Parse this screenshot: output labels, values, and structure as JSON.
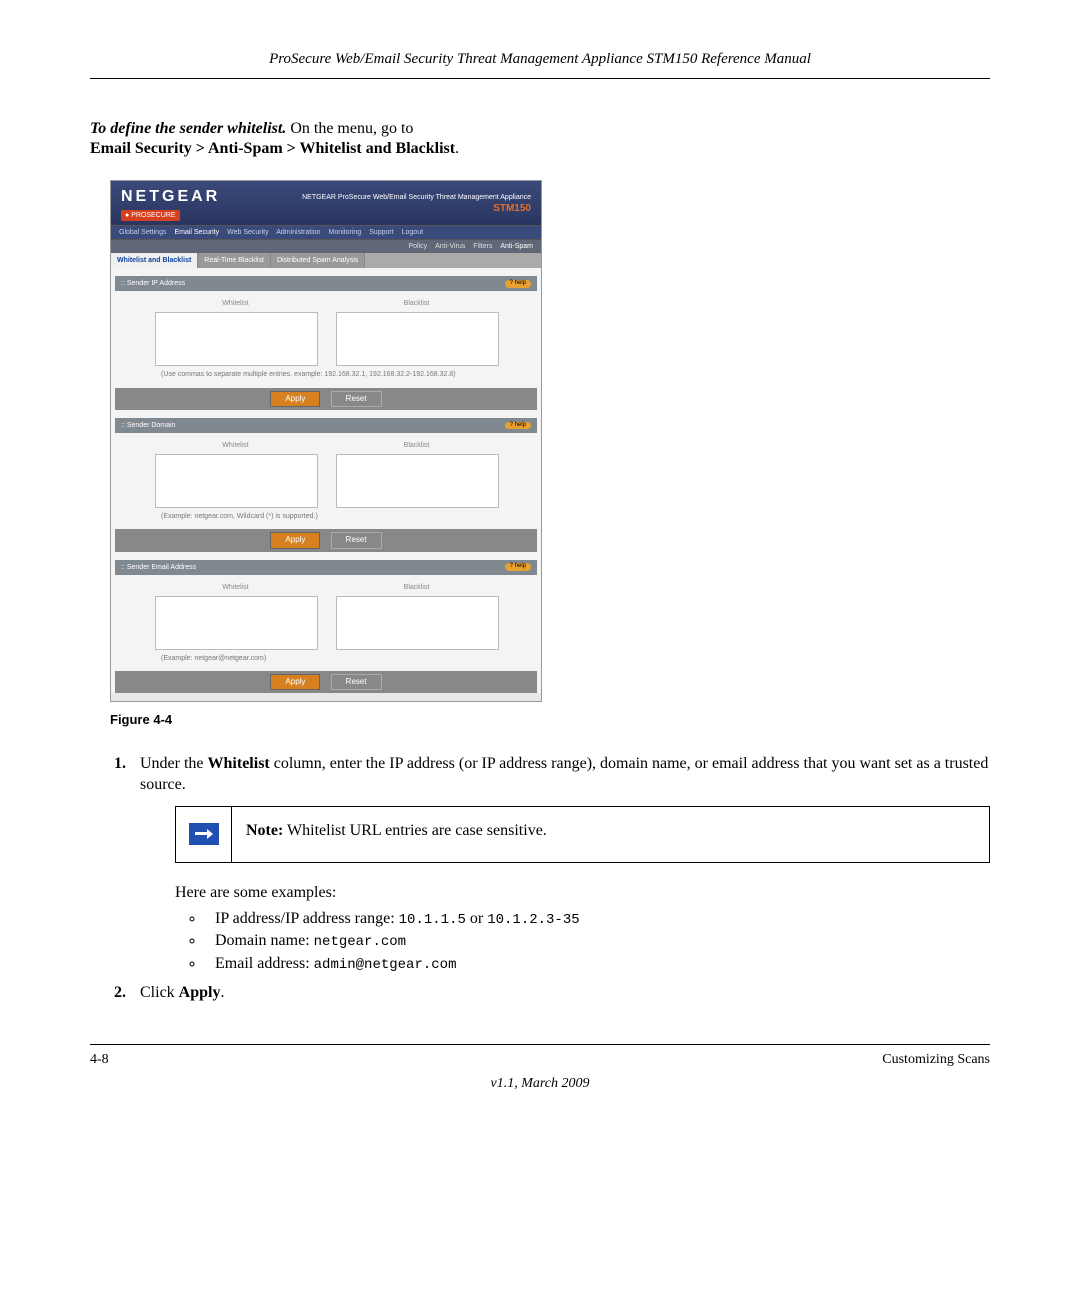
{
  "header": "ProSecure Web/Email Security Threat Management Appliance STM150 Reference Manual",
  "instruction_bold_italic": "To define the sender whitelist.",
  "instruction_text": " On the menu, go to ",
  "instruction_path": "Email Security > Anti-Spam > Whitelist and Blacklist",
  "screenshot": {
    "logo": "NETGEAR",
    "badge": "PROSECURE",
    "product_line": "NETGEAR ProSecure Web/Email Security Threat Management Appliance",
    "model": "STM150",
    "mainnav": [
      "Global Settings",
      "Email Security",
      "Web Security",
      "Administration",
      "Monitoring",
      "Support",
      "Logout"
    ],
    "subnav": [
      "Policy",
      "Anti-Virus",
      "Filters",
      "Anti-Spam"
    ],
    "tabs": [
      "Whitelist and Blacklist",
      "Real-Time Blacklist",
      "Distributed Spam Analysis"
    ],
    "help": "? help",
    "whitelist_label": "Whitelist",
    "blacklist_label": "Blacklist",
    "apply": "Apply",
    "reset": "Reset",
    "panel1": {
      "title": "Sender IP Address",
      "note": "(Use commas to separate multiple entries. example: 192.168.32.1, 192.168.32.2-192.168.32.8)"
    },
    "panel2": {
      "title": "Sender Domain",
      "note": "(Example: netgear.com, Wildcard (*) is supported.)"
    },
    "panel3": {
      "title": "Sender Email Address",
      "note": "(Example: netgear@netgear.com)"
    }
  },
  "figure_caption": "Figure 4-4",
  "step1_pre": "Under the ",
  "step1_bold": "Whitelist",
  "step1_post": " column, enter the IP address (or IP address range), domain name, or email address that you want set as a trusted source.",
  "note_label": "Note:",
  "note_text": " Whitelist URL entries are case sensitive.",
  "examples_intro": "Here are some examples:",
  "example1_label": "IP address/IP address range: ",
  "example1_a": "10.1.1.5",
  "example1_mid": " or ",
  "example1_b": "10.1.2.3-35",
  "example2_label": "Domain name: ",
  "example2_val": "netgear.com",
  "example3_label": "Email address: ",
  "example3_val": "admin@netgear.com",
  "step2_pre": "Click ",
  "step2_bold": "Apply",
  "footer_left": "4-8",
  "footer_right": "Customizing Scans",
  "version": "v1.1, March 2009"
}
